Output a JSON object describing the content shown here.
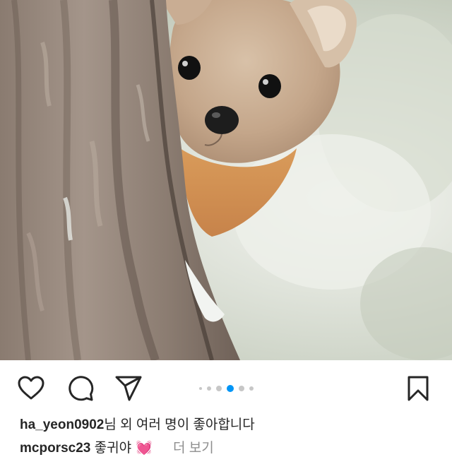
{
  "post": {
    "image_alt": "pine marten peeking from behind a tree trunk",
    "carousel": {
      "count": 6,
      "active_index": 3
    },
    "actions": {
      "like_icon": "heart-outline-icon",
      "comment_icon": "comment-bubble-icon",
      "share_icon": "paper-plane-icon",
      "save_icon": "bookmark-icon"
    },
    "likes": {
      "username": "ha_yeon0902",
      "suffix": "님 외 여러 명이 좋아합니다"
    },
    "comment": {
      "username": "mcporsc23",
      "text": "좋귀야",
      "emoji": "💓",
      "more_label": "더 보기"
    }
  },
  "colors": {
    "accent": "#0095f6",
    "text": "#262626",
    "muted": "#8e8e8e"
  }
}
